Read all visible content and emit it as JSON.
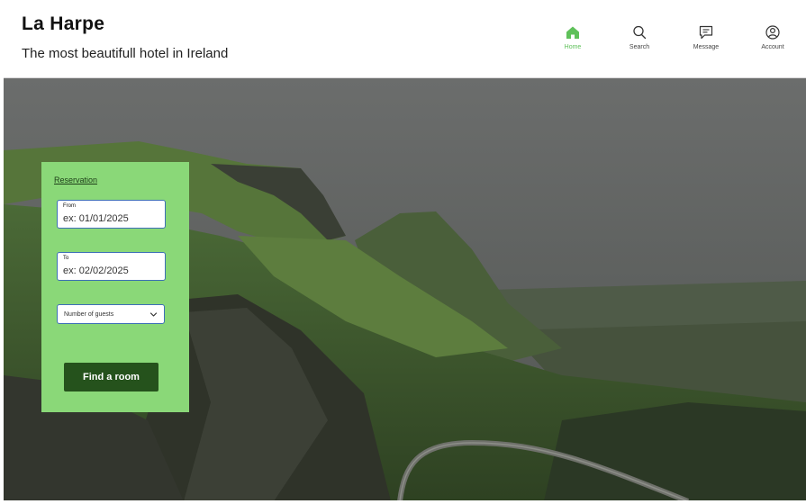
{
  "header": {
    "title": "La Harpe",
    "subtitle": "The most beautifull hotel in Ireland"
  },
  "nav": {
    "home": {
      "label": "Home",
      "icon": "home-icon",
      "active": true
    },
    "search": {
      "label": "Search",
      "icon": "search-icon"
    },
    "message": {
      "label": "Message",
      "icon": "message-icon"
    },
    "account": {
      "label": "Account",
      "icon": "account-icon"
    }
  },
  "reservation": {
    "title": "Reservation",
    "from": {
      "label": "From",
      "placeholder": "ex: 01/01/2025"
    },
    "to": {
      "label": "To",
      "placeholder": "ex: 02/02/2025"
    },
    "guests": {
      "selected": "Number of guests"
    },
    "submit_label": "Find a room"
  },
  "colors": {
    "accent": "#5fc15a",
    "panel": "#8ad878",
    "button": "#25521c"
  }
}
